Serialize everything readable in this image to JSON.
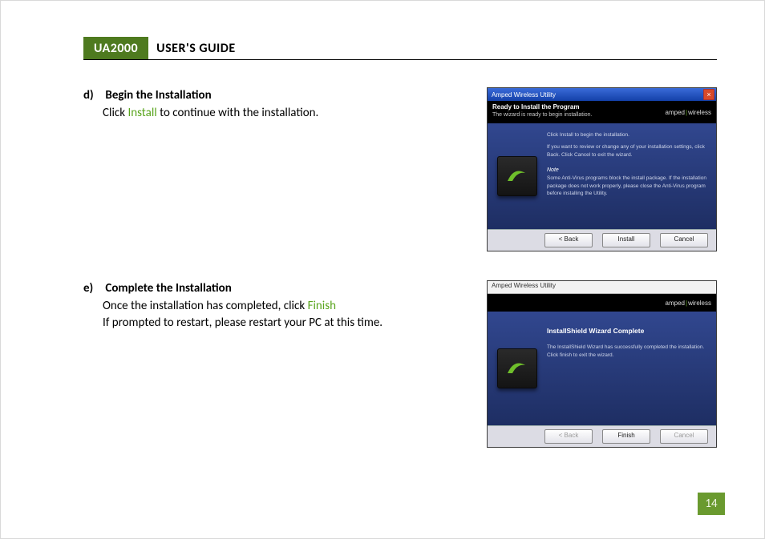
{
  "header": {
    "badge": "UA2000",
    "title": "USER'S GUIDE"
  },
  "steps": {
    "d": {
      "label": "d)",
      "title": "Begin the Installation",
      "line1a": "Click ",
      "line1hl": "Install",
      "line1b": " to continue with the installation."
    },
    "e": {
      "label": "e)",
      "title": "Complete the Installation",
      "line1a": "Once the installation has completed, click ",
      "line1hl": "Finish",
      "line2": "If prompted to restart, please restart your PC at this time."
    }
  },
  "dialog1": {
    "window_title": "Amped Wireless Utility",
    "close_glyph": "×",
    "banner_heading": "Ready to Install the Program",
    "banner_sub": "The wizard is ready to begin installation.",
    "brand_left": "amped",
    "brand_sep": "|",
    "brand_right": "wireless",
    "body_line1": "Click Install to begin the installation.",
    "body_line2": "If you want to review or change any of your installation settings, click Back. Click Cancel to exit the wizard.",
    "note_label": "Note",
    "note_text": "Some Anti-Virus programs block the install package. If the installation package does not work properly, please close the Anti-Virus program before installing the Utility.",
    "buttons": {
      "back": "< Back",
      "install": "Install",
      "cancel": "Cancel"
    }
  },
  "dialog2": {
    "window_title": "Amped Wireless Utility",
    "brand_left": "amped",
    "brand_sep": "|",
    "brand_right": "wireless",
    "heading": "InstallShield Wizard Complete",
    "body": "The InstallShield Wizard has successfully completed the installation. Click finish to exit the wizard.",
    "buttons": {
      "back": "< Back",
      "finish": "Finish",
      "cancel": "Cancel"
    }
  },
  "page_number": "14"
}
